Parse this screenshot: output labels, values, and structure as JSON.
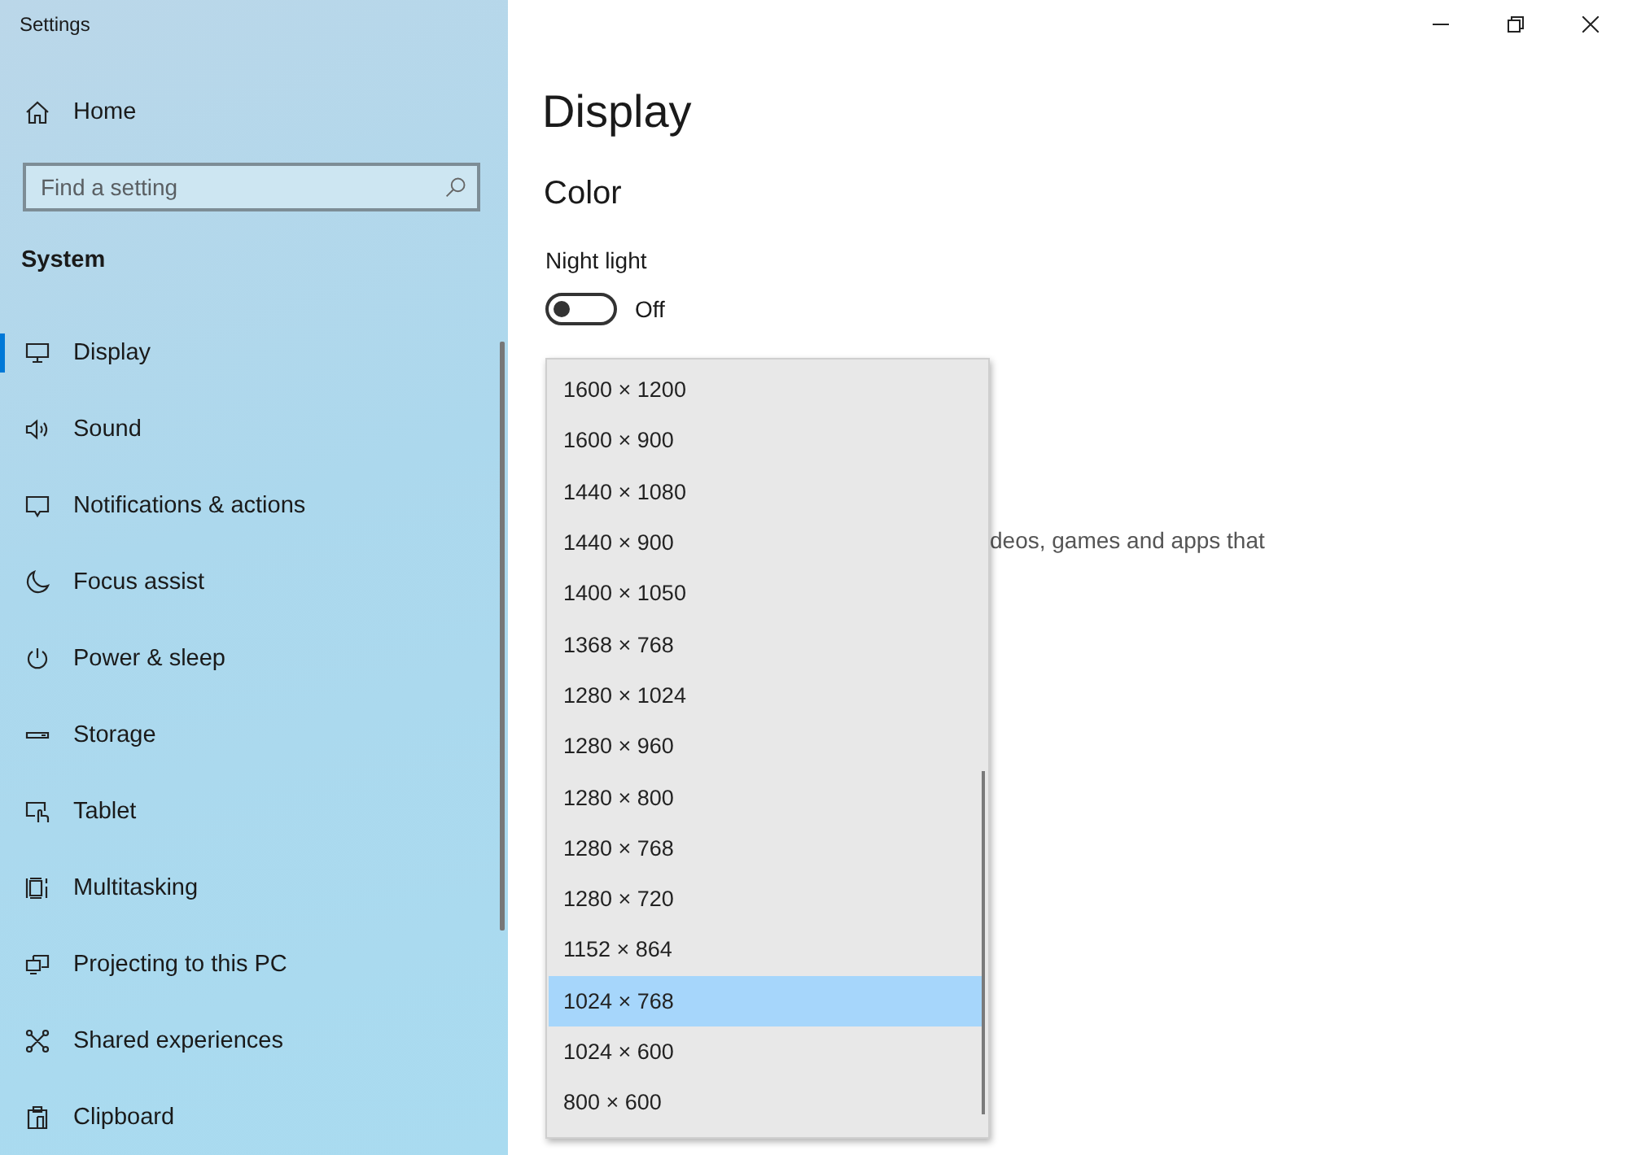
{
  "window": {
    "title": "Settings"
  },
  "sidebar": {
    "home": "Home",
    "search": {
      "placeholder": "Find a setting"
    },
    "section": "System",
    "items": [
      {
        "label": "Display",
        "selected": true
      },
      {
        "label": "Sound",
        "selected": false
      },
      {
        "label": "Notifications & actions",
        "selected": false
      },
      {
        "label": "Focus assist",
        "selected": false
      },
      {
        "label": "Power & sleep",
        "selected": false
      },
      {
        "label": "Storage",
        "selected": false
      },
      {
        "label": "Tablet",
        "selected": false
      },
      {
        "label": "Multitasking",
        "selected": false
      },
      {
        "label": "Projecting to this PC",
        "selected": false
      },
      {
        "label": "Shared experiences",
        "selected": false
      },
      {
        "label": "Clipboard",
        "selected": false
      }
    ]
  },
  "page": {
    "title": "Display",
    "section": "Color",
    "night_light": {
      "label": "Night light",
      "on": false,
      "state": "Off"
    },
    "description_fragment": "deos, games and apps that"
  },
  "resolution_menu": {
    "options": [
      {
        "label": "1600 × 1200",
        "selected": false
      },
      {
        "label": "1600 × 900",
        "selected": false
      },
      {
        "label": "1440 × 1080",
        "selected": false
      },
      {
        "label": "1440 × 900",
        "selected": false
      },
      {
        "label": "1400 × 1050",
        "selected": false
      },
      {
        "label": "1368 × 768",
        "selected": false
      },
      {
        "label": "1280 × 1024",
        "selected": false
      },
      {
        "label": "1280 × 960",
        "selected": false
      },
      {
        "label": "1280 × 800",
        "selected": false
      },
      {
        "label": "1280 × 768",
        "selected": false
      },
      {
        "label": "1280 × 720",
        "selected": false
      },
      {
        "label": "1152 × 864",
        "selected": false
      },
      {
        "label": "1024 × 768",
        "selected": true
      },
      {
        "label": "1024 × 600",
        "selected": false
      },
      {
        "label": "800 × 600",
        "selected": false
      }
    ]
  }
}
